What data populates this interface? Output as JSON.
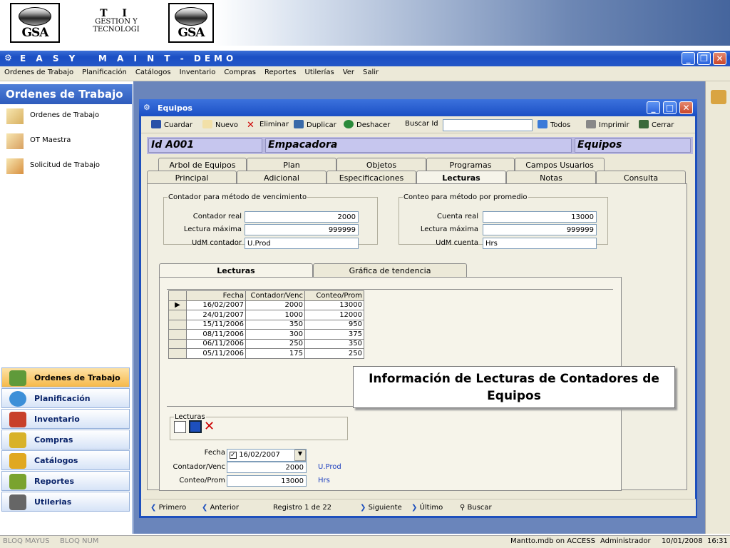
{
  "banner": {
    "logo_text": "GSA",
    "ti_line1": "T I",
    "ti_line2": "GESTION Y",
    "ti_line3": "TECNOLOGI"
  },
  "app": {
    "title": "E A S Y   M A I N T - DEMO",
    "menu": [
      "Ordenes de Trabajo",
      "Planificación",
      "Catálogos",
      "Inventario",
      "Compras",
      "Reportes",
      "Utilerías",
      "Ver",
      "Salir"
    ]
  },
  "sidebar": {
    "title": "Ordenes de Trabajo",
    "items": [
      {
        "label": "Ordenes de Trabajo",
        "icon": "work-order-icon"
      },
      {
        "label": "OT Maestra",
        "icon": "master-order-icon"
      },
      {
        "label": "Solicitud de Trabajo",
        "icon": "work-request-icon"
      }
    ],
    "nav": [
      {
        "label": "Ordenes de Trabajo",
        "active": true,
        "color": "#5f9a3a",
        "icon": "work-orders-nav-icon"
      },
      {
        "label": "Planificación",
        "active": false,
        "color": "#3c8fd8",
        "icon": "planning-clock-icon"
      },
      {
        "label": "Inventario",
        "active": false,
        "color": "#c8402a",
        "icon": "inventory-shelf-icon"
      },
      {
        "label": "Compras",
        "active": false,
        "color": "#d8b22a",
        "icon": "purchases-person-icon"
      },
      {
        "label": "Catálogos",
        "active": false,
        "color": "#e0a820",
        "icon": "catalogs-books-icon"
      },
      {
        "label": "Reportes",
        "active": false,
        "color": "#7aa32e",
        "icon": "reports-chart-icon"
      },
      {
        "label": "Utilerias",
        "active": false,
        "color": "#666666",
        "icon": "utilities-tower-icon"
      }
    ]
  },
  "window": {
    "title": "Equipos",
    "toolbar": {
      "save": "Cuardar",
      "new": "Nuevo",
      "delete": "Eliminar",
      "duplicate": "Duplicar",
      "undo": "Deshacer",
      "search_label": "Buscar Id",
      "search_value": "",
      "all": "Todos",
      "print": "Imprimir",
      "close": "Cerrar"
    },
    "header": {
      "id": "Id  A001",
      "name": "Empacadora",
      "type": "Equipos"
    },
    "tabs_row1": [
      "Arbol de Equipos",
      "Plan",
      "Objetos",
      "Programas",
      "Campos Usuarios"
    ],
    "tabs_row2": [
      "Principal",
      "Adicional",
      "Especificaciones",
      "Lecturas",
      "Notas",
      "Consulta"
    ],
    "active_tab": "Lecturas",
    "contador": {
      "legend": "Contador para método de vencimiento",
      "real_label": "Contador real",
      "real_value": "2000",
      "max_label": "Lectura máxima",
      "max_value": "999999",
      "udm_label": "UdM contador",
      "udm_value": "U.Prod"
    },
    "conteo": {
      "legend": "Conteo para método por promedio",
      "real_label": "Cuenta real",
      "real_value": "13000",
      "max_label": "Lectura máxima",
      "max_value": "999999",
      "udm_label": "UdM cuenta",
      "udm_value": "Hrs"
    },
    "subtabs": [
      "Lecturas",
      "Gráfica de tendencia"
    ],
    "grid": {
      "columns": [
        "Fecha",
        "Contador/Venc",
        "Conteo/Prom"
      ],
      "rows": [
        [
          "16/02/2007",
          "2000",
          "13000"
        ],
        [
          "24/01/2007",
          "1000",
          "12000"
        ],
        [
          "15/11/2006",
          "350",
          "950"
        ],
        [
          "08/11/2006",
          "300",
          "375"
        ],
        [
          "06/11/2006",
          "250",
          "350"
        ],
        [
          "05/11/2006",
          "175",
          "250"
        ]
      ]
    },
    "callout": "Información de Lecturas de Contadores de Equipos",
    "lecturas_form": {
      "legend": "Lecturas",
      "fecha_label": "Fecha",
      "fecha_value": "16/02/2007",
      "contador_label": "Contador/Venc",
      "contador_value": "2000",
      "contador_unit": "U.Prod",
      "conteo_label": "Conteo/Prom",
      "conteo_value": "13000",
      "conteo_unit": "Hrs"
    },
    "nav": {
      "first": "Primero",
      "prev": "Anterior",
      "record": "Registro 1 de 22",
      "next": "Siguiente",
      "last": "Último",
      "search": "Buscar"
    }
  },
  "statusbar": {
    "caps": "BLOQ MAYUS",
    "num": "BLOQ NUM",
    "db": "Mantto.mdb on ACCESS",
    "user": "Administrador",
    "date": "10/01/2008",
    "time": "16:31"
  }
}
